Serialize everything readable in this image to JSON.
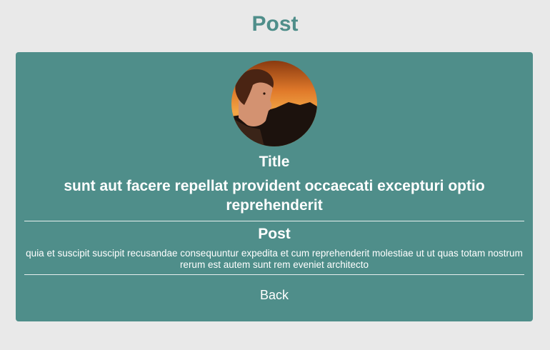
{
  "header": {
    "title": "Post"
  },
  "post": {
    "title_label": "Title",
    "title": "sunt aut facere repellat provident occaecati excepturi optio reprehenderit",
    "body_label": "Post",
    "body": "quia et suscipit suscipit recusandae consequuntur expedita et cum reprehenderit molestiae ut ut quas totam nostrum rerum est autem sunt rem eveniet architecto",
    "back_label": "Back"
  },
  "colors": {
    "background": "#e9e9e9",
    "accent": "#4f8e8a",
    "text_on_accent": "#ffffff"
  }
}
